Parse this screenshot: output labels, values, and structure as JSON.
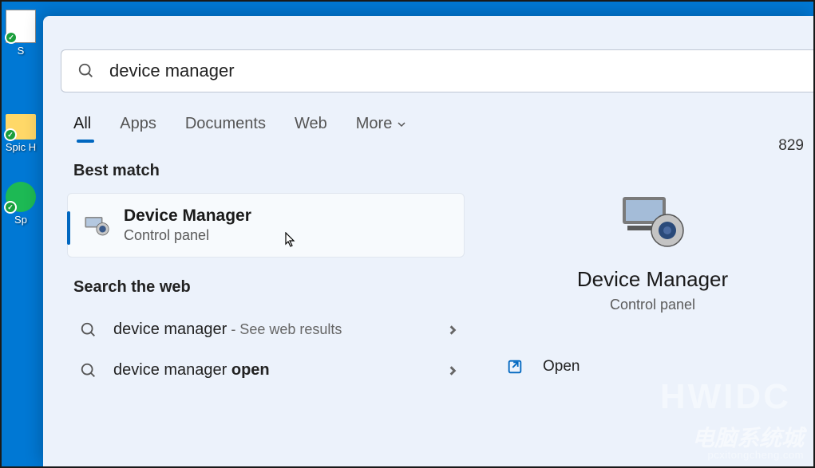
{
  "desktop": {
    "icons": [
      {
        "label": "S"
      },
      {
        "label": "Spic H"
      },
      {
        "label": "Sp"
      }
    ]
  },
  "search": {
    "query": "device manager"
  },
  "tabs": {
    "items": [
      "All",
      "Apps",
      "Documents",
      "Web",
      "More"
    ],
    "active_index": 0
  },
  "top_right_badge": "829",
  "best_match": {
    "heading": "Best match",
    "title": "Device Manager",
    "subtitle": "Control panel"
  },
  "web_search": {
    "heading": "Search the web",
    "items": [
      {
        "prefix": "device manager",
        "suffix_plain": " - See web results",
        "suffix_bold": ""
      },
      {
        "prefix": "device manager ",
        "suffix_plain": "",
        "suffix_bold": "open"
      }
    ]
  },
  "preview": {
    "title": "Device Manager",
    "subtitle": "Control panel",
    "actions": [
      {
        "label": "Open",
        "icon": "open-external"
      }
    ]
  },
  "watermark": {
    "big": "HWIDC",
    "line1": "电脑系统城",
    "line2": "pcxitongcheng.com"
  }
}
